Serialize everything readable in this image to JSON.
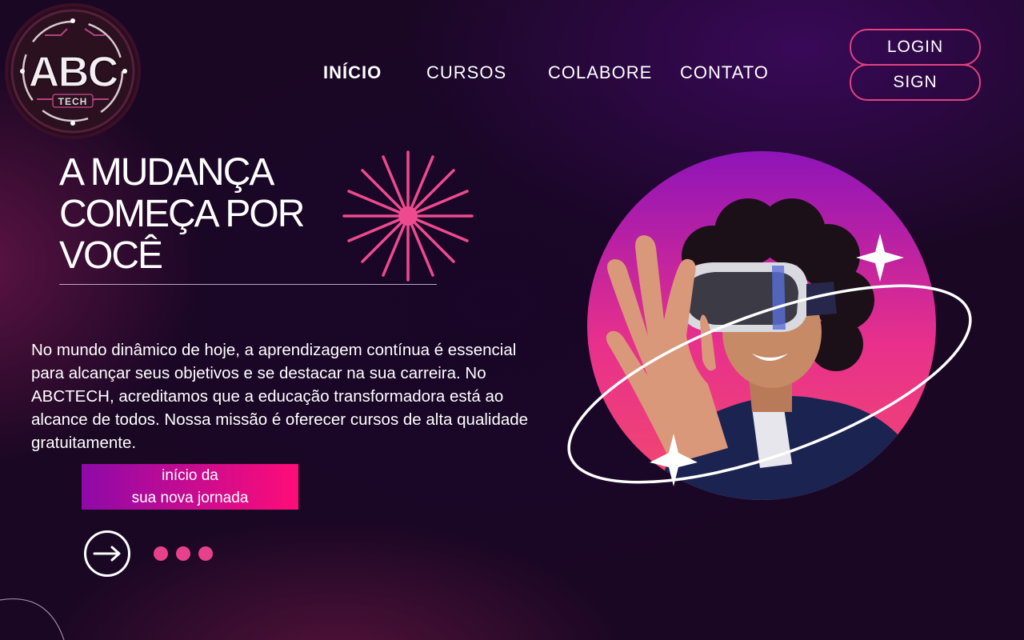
{
  "logo": {
    "text": "ABC",
    "subtext": "TECH"
  },
  "nav": {
    "items": [
      {
        "label": "INÍCIO",
        "active": true
      },
      {
        "label": "CURSOS",
        "active": false
      },
      {
        "label": "COLABORE",
        "active": false
      },
      {
        "label": "CONTATO",
        "active": false
      }
    ]
  },
  "auth": {
    "login_label": "LOGIN",
    "sign_label": "SIGN"
  },
  "hero": {
    "headline": "A MUDANÇA\nCOMEÇA POR\nVOCÊ",
    "description": "No mundo dinâmico de hoje, a aprendizagem contínua é essencial para alcançar seus objetivos e se destacar na sua carreira. No ABCTECH, acreditamos que a educação transformadora está ao alcance de todos. Nossa missão é oferecer cursos de alta qualidade gratuitamente.",
    "cta_line1": "início da",
    "cta_line2": "sua nova jornada"
  },
  "carousel": {
    "dot_count": 3
  },
  "colors": {
    "accent": "#e8418c",
    "button_border": "#e4407e",
    "cta_gradient_start": "#8e0aa8",
    "cta_gradient_end": "#ff0d78",
    "background": "#1a0724"
  },
  "icons": {
    "next": "arrow-right-icon",
    "burst": "starburst-icon",
    "sparkle": "sparkle-icon"
  }
}
